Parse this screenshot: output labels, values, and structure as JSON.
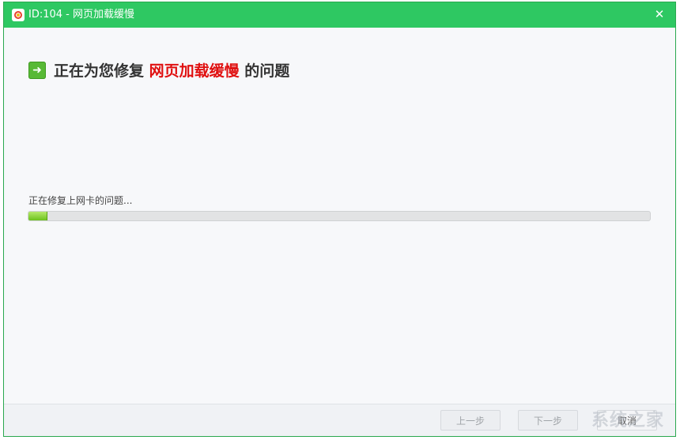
{
  "window": {
    "title": "ID:104 - 网页加载缓慢",
    "close_label": "✕"
  },
  "heading": {
    "prefix": "正在为您修复",
    "highlight": "网页加载缓慢",
    "suffix": "的问题"
  },
  "status": {
    "text": "正在修复上网卡的问题...",
    "progress_fraction": 0.03
  },
  "footer": {
    "prev_label": "上一步",
    "next_label": "下一步",
    "cancel_label": "取消"
  },
  "watermark": "系统之家",
  "colors": {
    "titlebar": "#2ec862",
    "highlight": "#e01010",
    "progress": "#6cc21e"
  }
}
